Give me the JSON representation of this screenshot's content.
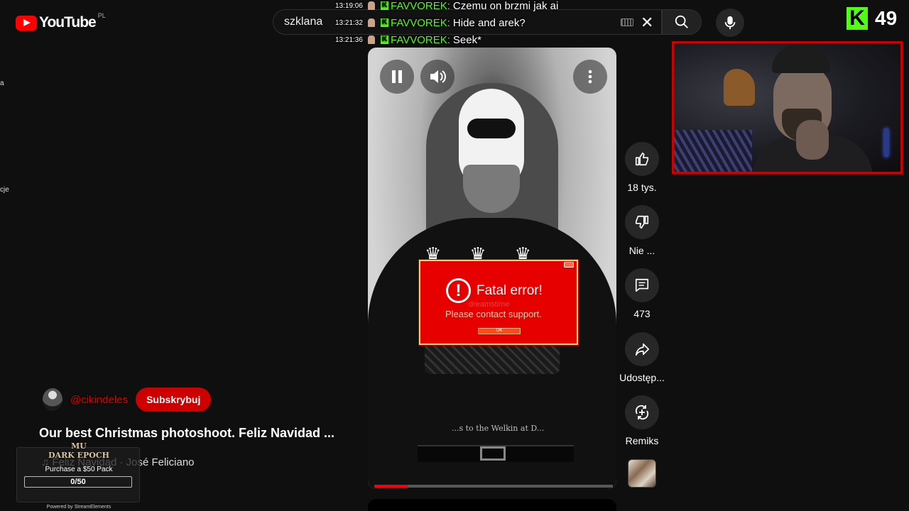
{
  "header": {
    "logo_text": "YouTube",
    "region": "PL",
    "search_value": "szklana"
  },
  "chat": [
    {
      "time": "13:19:06",
      "user": "FAVVOREK:",
      "message": "Czemu on brzmi jak ai"
    },
    {
      "time": "13:21:32",
      "user": "FAVVOREK:",
      "message": "Hide and arek?"
    },
    {
      "time": "13:21:36",
      "user": "FAVVOREK:",
      "message": "Seek*"
    }
  ],
  "kick": {
    "badge": "K",
    "viewers": "49"
  },
  "sidebar_fragments": [
    "a",
    "cje"
  ],
  "video": {
    "progress_fraction": 0.14,
    "shirt_text": "...s to the Welkin at D..."
  },
  "error_popup": {
    "title": "Fatal error!",
    "message": "Please contact support.",
    "watermark": "dreamstime",
    "ok_label": "OK"
  },
  "actions": [
    {
      "icon": "like-icon",
      "label": "18 tys."
    },
    {
      "icon": "dislike-icon",
      "label": "Nie ..."
    },
    {
      "icon": "comments-icon",
      "label": "473"
    },
    {
      "icon": "share-icon",
      "label": "Udostęp..."
    },
    {
      "icon": "remix-icon",
      "label": "Remiks"
    }
  ],
  "channel": {
    "handle": "@cikindeles",
    "subscribe_label": "Subskrybuj"
  },
  "title": "Our best Christmas photoshoot. Feliz Navidad ...",
  "music": "♫ Feliz Navidad · José Feliciano",
  "streamelements": {
    "logo_line1": "MU",
    "logo_line2": "DARK EPOCH",
    "goal_text": "Purchase a $50 Pack",
    "progress": "0/50",
    "powered": "Powered by StreamElements"
  },
  "colors": {
    "accent": "#ff0000",
    "kick_green": "#53fc18",
    "error_red": "#e60000"
  }
}
